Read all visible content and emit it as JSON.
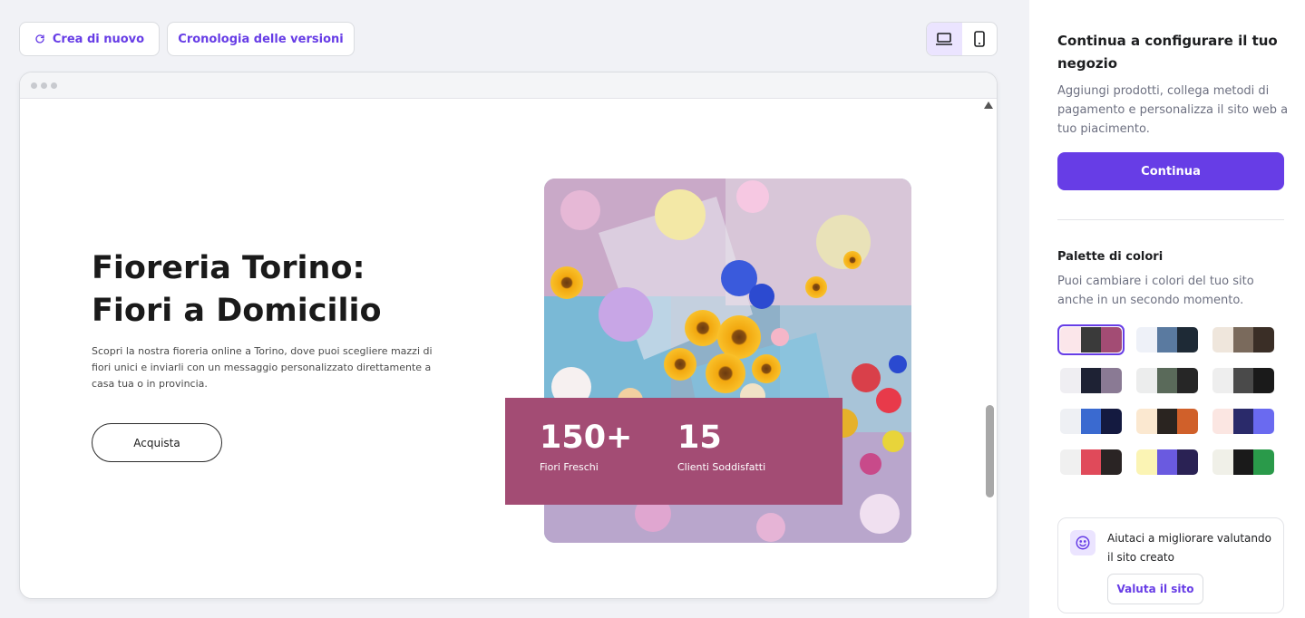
{
  "toolbar": {
    "new_label": "Crea di nuovo",
    "history_label": "Cronologia delle versioni"
  },
  "device_toggle": {
    "active": "desktop"
  },
  "site": {
    "title": "Fioreria Torino: Fiori a Domicilio",
    "description": "Scopri la nostra fioreria online a Torino, dove puoi scegliere mazzi di fiori unici e inviarli con un messaggio personalizzato direttamente a casa tua o in provincia.",
    "cta_label": "Acquista",
    "stats": [
      {
        "value": "150+",
        "label": "Fiori Freschi"
      },
      {
        "value": "15",
        "label": "Clienti Soddisfatti"
      }
    ],
    "accent_color": "#a34c74"
  },
  "sidebar": {
    "title": "Continua a configurare il tuo negozio",
    "description": "Aggiungi prodotti, collega metodi di pagamento e personalizza il sito web a tuo piacimento.",
    "continue_label": "Continua",
    "palette_title": "Palette di colori",
    "palette_description": "Puoi cambiare i colori del tuo sito anche in un secondo momento.",
    "palettes": [
      {
        "colors": [
          "#fbe6ea",
          "#3a3a3a",
          "#a34c74"
        ],
        "selected": true
      },
      {
        "colors": [
          "#eef1f8",
          "#5a7aa0",
          "#1e2a36"
        ],
        "selected": false
      },
      {
        "colors": [
          "#efe6dc",
          "#7a6a5c",
          "#3a2e26"
        ],
        "selected": false
      },
      {
        "colors": [
          "#efeef2",
          "#1e2234",
          "#8a7a94"
        ],
        "selected": false
      },
      {
        "colors": [
          "#eceded",
          "#5a6a5a",
          "#262626"
        ],
        "selected": false
      },
      {
        "colors": [
          "#eeeeee",
          "#4a4a4a",
          "#1a1a1a"
        ],
        "selected": false
      },
      {
        "colors": [
          "#eef0f4",
          "#3a6ad0",
          "#141a40"
        ],
        "selected": false
      },
      {
        "colors": [
          "#fbe8d0",
          "#2a2420",
          "#d0602a"
        ],
        "selected": false
      },
      {
        "colors": [
          "#fbe6e2",
          "#2a2a6a",
          "#6a6af0"
        ],
        "selected": false
      },
      {
        "colors": [
          "#f0f0f0",
          "#e04a5a",
          "#2a2424"
        ],
        "selected": false
      },
      {
        "colors": [
          "#fbf4b4",
          "#6a5ae0",
          "#2a2254"
        ],
        "selected": false
      },
      {
        "colors": [
          "#f0f0e8",
          "#1a1a1a",
          "#2a9a4a"
        ],
        "selected": false
      }
    ],
    "feedback": {
      "text": "Aiutaci a migliorare valutando il sito creato",
      "button_label": "Valuta il sito"
    },
    "brand_color": "#673de6"
  }
}
